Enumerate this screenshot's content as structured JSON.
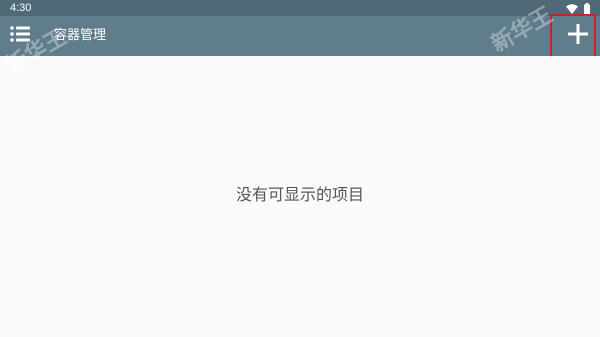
{
  "status_bar": {
    "time": "4:30",
    "icons": [
      "wifi-icon",
      "battery-icon"
    ]
  },
  "app_bar": {
    "title": "容器管理",
    "menu_icon": "menu-icon",
    "add_icon": "add-icon"
  },
  "content": {
    "empty_message": "没有可显示的项目"
  },
  "watermark": {
    "text": "新华王"
  },
  "colors": {
    "status_bar": "#4f6a76",
    "app_bar": "#5f7d8b",
    "background": "#fafafa",
    "highlight": "#c8232c"
  }
}
